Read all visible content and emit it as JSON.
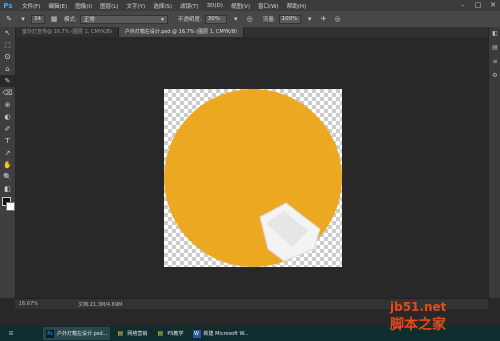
{
  "app": {
    "logo": "Ps",
    "accent": "#31a8ff"
  },
  "menu": {
    "items": [
      "文件(F)",
      "编辑(E)",
      "图像(I)",
      "图层(L)",
      "文字(Y)",
      "选择(S)",
      "滤镜(T)",
      "3D(D)",
      "视图(V)",
      "窗口(W)",
      "帮助(H)"
    ],
    "window_controls": [
      "–",
      "□",
      "✕"
    ]
  },
  "options": {
    "brush_size": "34",
    "mode_label": "模式:",
    "mode_value": "正常",
    "opacity_label": "不透明度:",
    "opacity_value": "30%",
    "flow_label": "流量:",
    "flow_value": "100%"
  },
  "tabs": [
    "室外灯宣传@ 16.7% (图层 1, CMYK/8)",
    "户外灯箱左设计.psd @ 16.7% (图层 1, CMYK/8)"
  ],
  "tools": [
    "↖",
    "⬚",
    "ʘ",
    "⌂",
    "✎",
    "⌫",
    "⊕",
    "◐",
    "✐",
    "T",
    "↗",
    "✋",
    "🔍",
    "◧"
  ],
  "right_tools": [
    "◧",
    "▤",
    "≡",
    "⚙"
  ],
  "canvas": {
    "fill_color": "#eca820"
  },
  "status": {
    "zoom": "16.67%",
    "doc": "文档:21.3M/4.69M"
  },
  "taskbar": {
    "items": [
      {
        "icon": "Ps",
        "label": "户外灯箱左设计.psd..."
      },
      {
        "icon": "▤",
        "label": "网络营销"
      },
      {
        "icon": "▤",
        "label": "PS教学"
      },
      {
        "icon": "W",
        "label": "新建 Microsoft W..."
      }
    ]
  },
  "watermark": {
    "site": "jb51.net",
    "text": "脚本之家"
  }
}
